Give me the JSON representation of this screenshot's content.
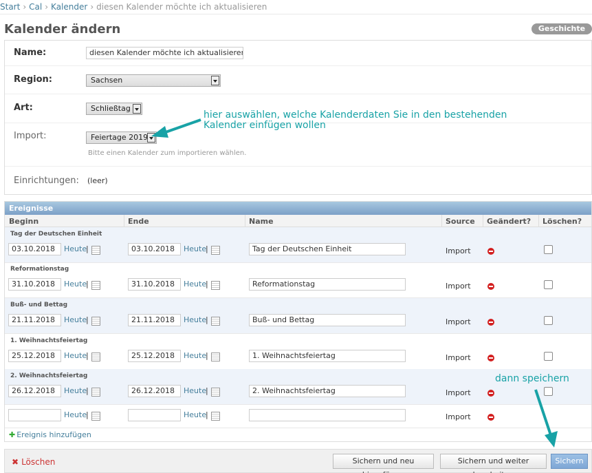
{
  "breadcrumb": {
    "start": "Start",
    "cal": "Cal",
    "kalender": "Kalender",
    "current": "diesen Kalender möchte ich aktualisieren",
    "separator": "›"
  },
  "title": "Kalender ändern",
  "history_button": "Geschichte",
  "form": {
    "name_label": "Name:",
    "name_value": "diesen Kalender möchte ich aktualisieren",
    "region_label": "Region:",
    "region_value": "Sachsen",
    "art_label": "Art:",
    "art_value": "Schließtag",
    "import_label": "Import:",
    "import_value": "Feiertage 2019",
    "import_help": "Bitte einen Kalender zum importieren wählen.",
    "einrichtungen_label": "Einrichtungen:",
    "einrichtungen_value": "(leer)"
  },
  "annotations": {
    "import_note": "hier auswählen, welche Kalenderdaten Sie in den bestehenden Kalender einfügen wollen",
    "save_note": "dann speichern"
  },
  "events": {
    "header": "Ereignisse",
    "columns": {
      "begin": "Beginn",
      "end": "Ende",
      "name": "Name",
      "source": "Source",
      "changed": "Geändert?",
      "delete": "Löschen?"
    },
    "today": "Heute",
    "pipe": "|",
    "rows": [
      {
        "title": "Tag der Deutschen Einheit",
        "begin": "03.10.2018",
        "end": "03.10.2018",
        "name": "Tag der Deutschen Einheit",
        "source": "Import"
      },
      {
        "title": "Reformationstag",
        "begin": "31.10.2018",
        "end": "31.10.2018",
        "name": "Reformationstag",
        "source": "Import"
      },
      {
        "title": "Buß- und Bettag",
        "begin": "21.11.2018",
        "end": "21.11.2018",
        "name": "Buß- und Bettag",
        "source": "Import"
      },
      {
        "title": "1. Weihnachtsfeiertag",
        "begin": "25.12.2018",
        "end": "25.12.2018",
        "name": "1. Weihnachtsfeiertag",
        "source": "Import"
      },
      {
        "title": "2. Weihnachtsfeiertag",
        "begin": "26.12.2018",
        "end": "26.12.2018",
        "name": "2. Weihnachtsfeiertag",
        "source": "Import"
      }
    ],
    "empty_row": {
      "source": "Import"
    },
    "add_link": "Ereignis hinzufügen",
    "add_plus": "✚"
  },
  "submit": {
    "delete": "Löschen",
    "delete_icon": "✖",
    "save_add": "Sichern und neu hinzufügen",
    "save_continue": "Sichern und weiter bearbeiten",
    "save": "Sichern"
  },
  "colors": {
    "link": "#447e9b",
    "annotation": "#18a2a6",
    "delete": "#d32020"
  }
}
